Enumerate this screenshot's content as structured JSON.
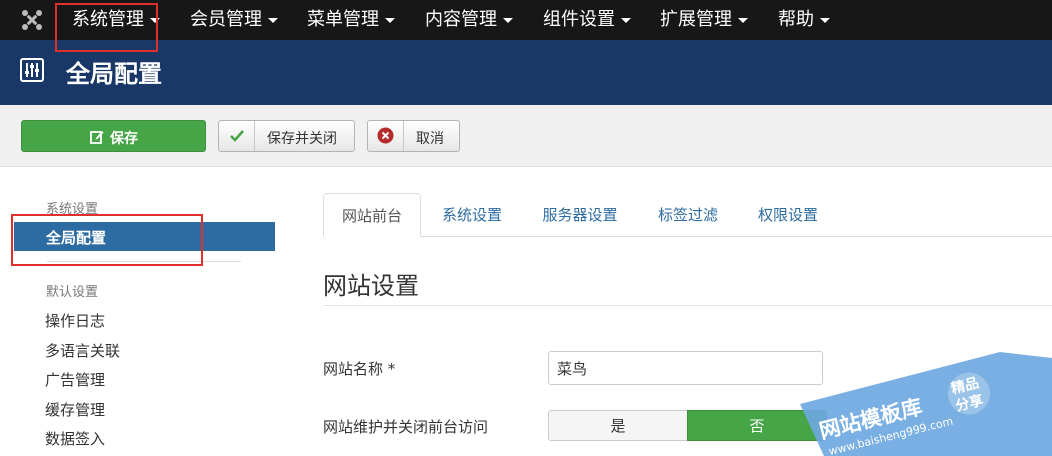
{
  "nav": {
    "items": [
      {
        "label": "系统管理"
      },
      {
        "label": "会员管理"
      },
      {
        "label": "菜单管理"
      },
      {
        "label": "内容管理"
      },
      {
        "label": "组件设置"
      },
      {
        "label": "扩展管理"
      },
      {
        "label": "帮助"
      }
    ]
  },
  "header": {
    "title": "全局配置"
  },
  "toolbar": {
    "save_label": "保存",
    "save_close_label": "保存并关闭",
    "cancel_label": "取消"
  },
  "sidebar": {
    "heading1": "系统设置",
    "active_item": "全局配置",
    "heading2": "默认设置",
    "items": [
      {
        "label": "操作日志"
      },
      {
        "label": "多语言关联"
      },
      {
        "label": "广告管理"
      },
      {
        "label": "缓存管理"
      },
      {
        "label": "数据签入"
      }
    ]
  },
  "tabs": [
    {
      "label": "网站前台",
      "active": true
    },
    {
      "label": "系统设置"
    },
    {
      "label": "服务器设置"
    },
    {
      "label": "标签过滤"
    },
    {
      "label": "权限设置"
    }
  ],
  "section": {
    "title": "网站设置"
  },
  "fields": {
    "site_name_label": "网站名称 *",
    "site_name_value": "菜鸟",
    "offline_label": "网站维护并关闭前台访问",
    "offline_yes": "是",
    "offline_no": "否"
  },
  "watermark": {
    "line1": "网站模板库",
    "line2": "www.baisheng999.com",
    "badge_top": "精品",
    "badge_bottom": "分享"
  },
  "colors": {
    "topbar": "#171717",
    "header": "#1a3867",
    "active": "#2d6ca2",
    "save": "#46a546",
    "highlight": "#e0302c"
  }
}
